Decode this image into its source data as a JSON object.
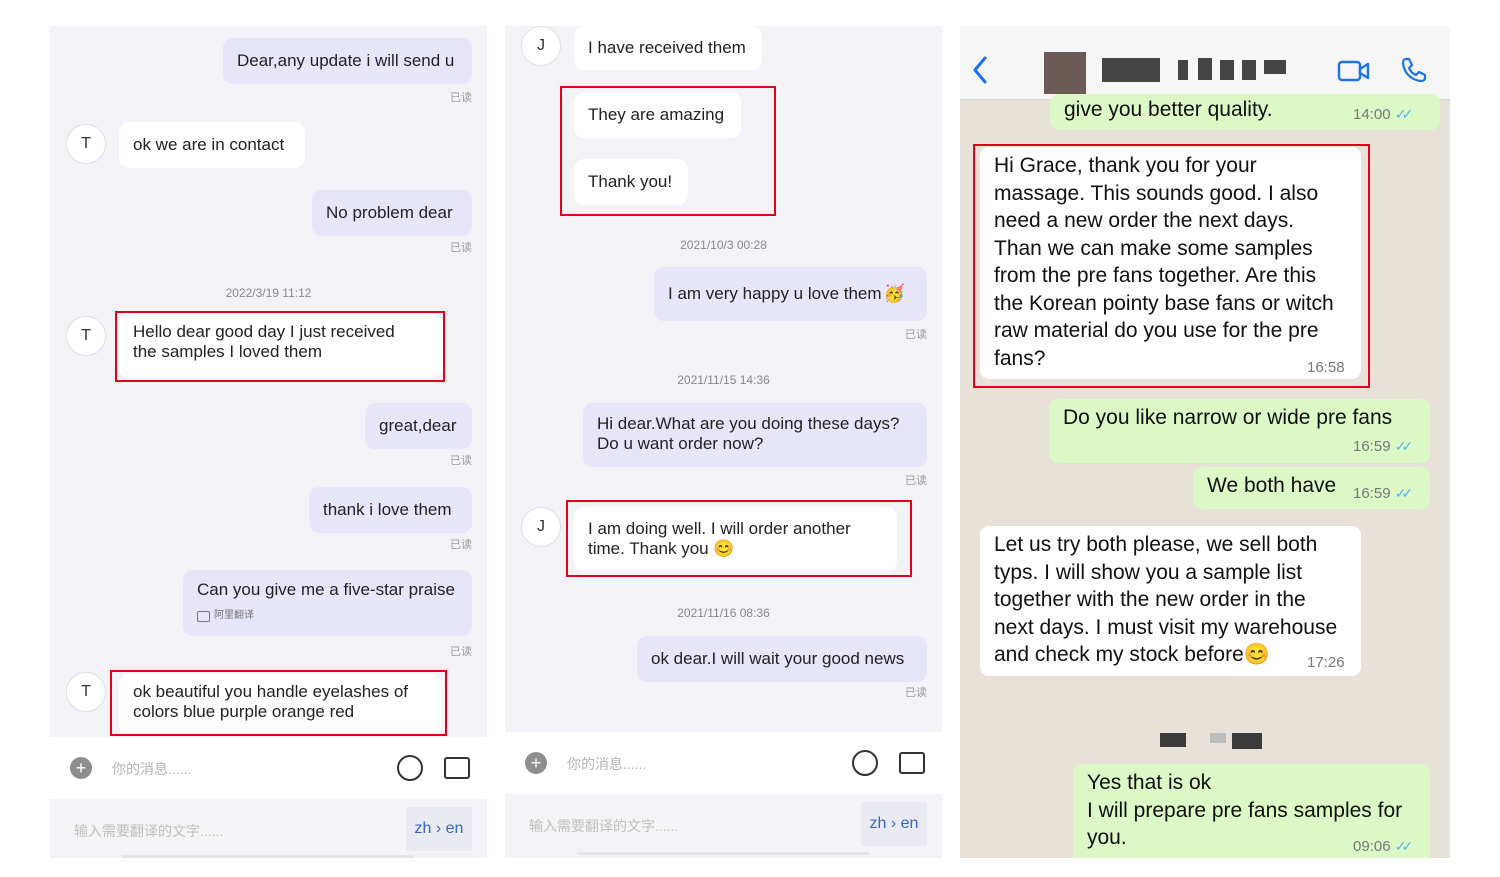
{
  "panel1": {
    "messages": [
      {
        "text": "Dear,any update i will send u",
        "read": "已读"
      },
      {
        "avatar": "T",
        "text": "ok we are in contact"
      },
      {
        "text": "No problem dear",
        "read": "已读"
      },
      {
        "timestamp": "2022/3/19 11:12"
      },
      {
        "avatar": "T",
        "lines": [
          "Hello dear good day I just received",
          "the samples I loved them"
        ]
      },
      {
        "text": "great,dear",
        "read": "已读"
      },
      {
        "text": "thank i love them",
        "read": "已读"
      },
      {
        "text": "Can you give me a five-star praise",
        "translation_label": "阿里翻译",
        "read": "已读"
      },
      {
        "avatar": "T",
        "lines": [
          "ok beautiful you handle eyelashes of",
          "colors blue purple orange red"
        ]
      }
    ],
    "input_placeholder": "你的消息......",
    "translate_placeholder": "输入需要翻译的文字......",
    "lang_switch": "zh › en"
  },
  "panel2": {
    "messages": [
      {
        "avatar": "J",
        "text": "I have received them"
      },
      {
        "text": "They are amazing"
      },
      {
        "text": "Thank you!"
      },
      {
        "timestamp": "2021/10/3 00:28"
      },
      {
        "text": "I am very happy u love them",
        "emoji": "🥳",
        "read": "已读"
      },
      {
        "timestamp": "2021/11/15 14:36"
      },
      {
        "lines": [
          "Hi dear.What are you doing these days?",
          "Do u want order now?"
        ],
        "read": "已读"
      },
      {
        "avatar": "J",
        "lines": [
          "I am doing well. I will order another",
          "time. Thank you 😊"
        ]
      },
      {
        "timestamp": "2021/11/16 08:36"
      },
      {
        "text": "ok dear.I will wait your good news",
        "read": "已读"
      }
    ],
    "input_placeholder": "你的消息......",
    "translate_placeholder": "输入需要翻译的文字......",
    "lang_switch": "zh › en"
  },
  "panel3": {
    "header": {
      "back_icon": "chevron-left-icon",
      "video_icon": "video-call-icon",
      "phone_icon": "phone-call-icon"
    },
    "messages": [
      {
        "text": "give you better quality.",
        "time": "14:00"
      },
      {
        "lines": [
          "Hi Grace, thank you for your",
          "massage. This sounds good. I also",
          "need a new order the next days.",
          "Than we can make some samples",
          "from the pre fans together. Are this",
          "the Korean pointy base fans or witch",
          "raw material do you use for the pre",
          "fans?"
        ],
        "time": "16:58"
      },
      {
        "text": "Do you like narrow or wide pre fans",
        "time": "16:59"
      },
      {
        "text": "We both have",
        "time": "16:59"
      },
      {
        "lines": [
          "Let us try both please, we sell both",
          "typs. I will show you a sample list",
          "together with the new order in the",
          "next days. I must visit my warehouse",
          "and check my stock before😊"
        ],
        "time": "17:26"
      },
      {
        "lines": [
          "Yes that is ok",
          "I will prepare pre fans samples for",
          "you."
        ],
        "time": "09:06"
      }
    ]
  },
  "colors": {
    "highlight": "#e3001b",
    "mine_bubble": "#e6e5fa",
    "wa_out": "#dcf8c6",
    "wa_ticks": "#4fb6ec",
    "ios_blue": "#1a73e8"
  }
}
